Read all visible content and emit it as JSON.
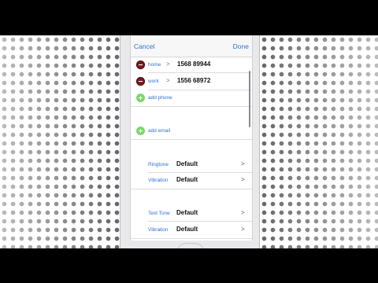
{
  "navbar": {
    "cancel": "Cancel",
    "done": "Done"
  },
  "phones": [
    {
      "label": "home",
      "number": "1568 89944"
    },
    {
      "label": "work",
      "number": "1556 68972"
    }
  ],
  "add_phone": "add phone",
  "add_email": "add email",
  "sounds_group_1": [
    {
      "label": "Ringtone",
      "value": "Default"
    },
    {
      "label": "Vibration",
      "value": "Default"
    }
  ],
  "sounds_group_2": [
    {
      "label": "Text Tone",
      "value": "Default"
    },
    {
      "label": "Vibration",
      "value": "Default"
    }
  ],
  "chevron": ">",
  "colors": {
    "accent": "#2f6fd6",
    "delete": "#7a1c24",
    "add": "#7bd86b"
  }
}
